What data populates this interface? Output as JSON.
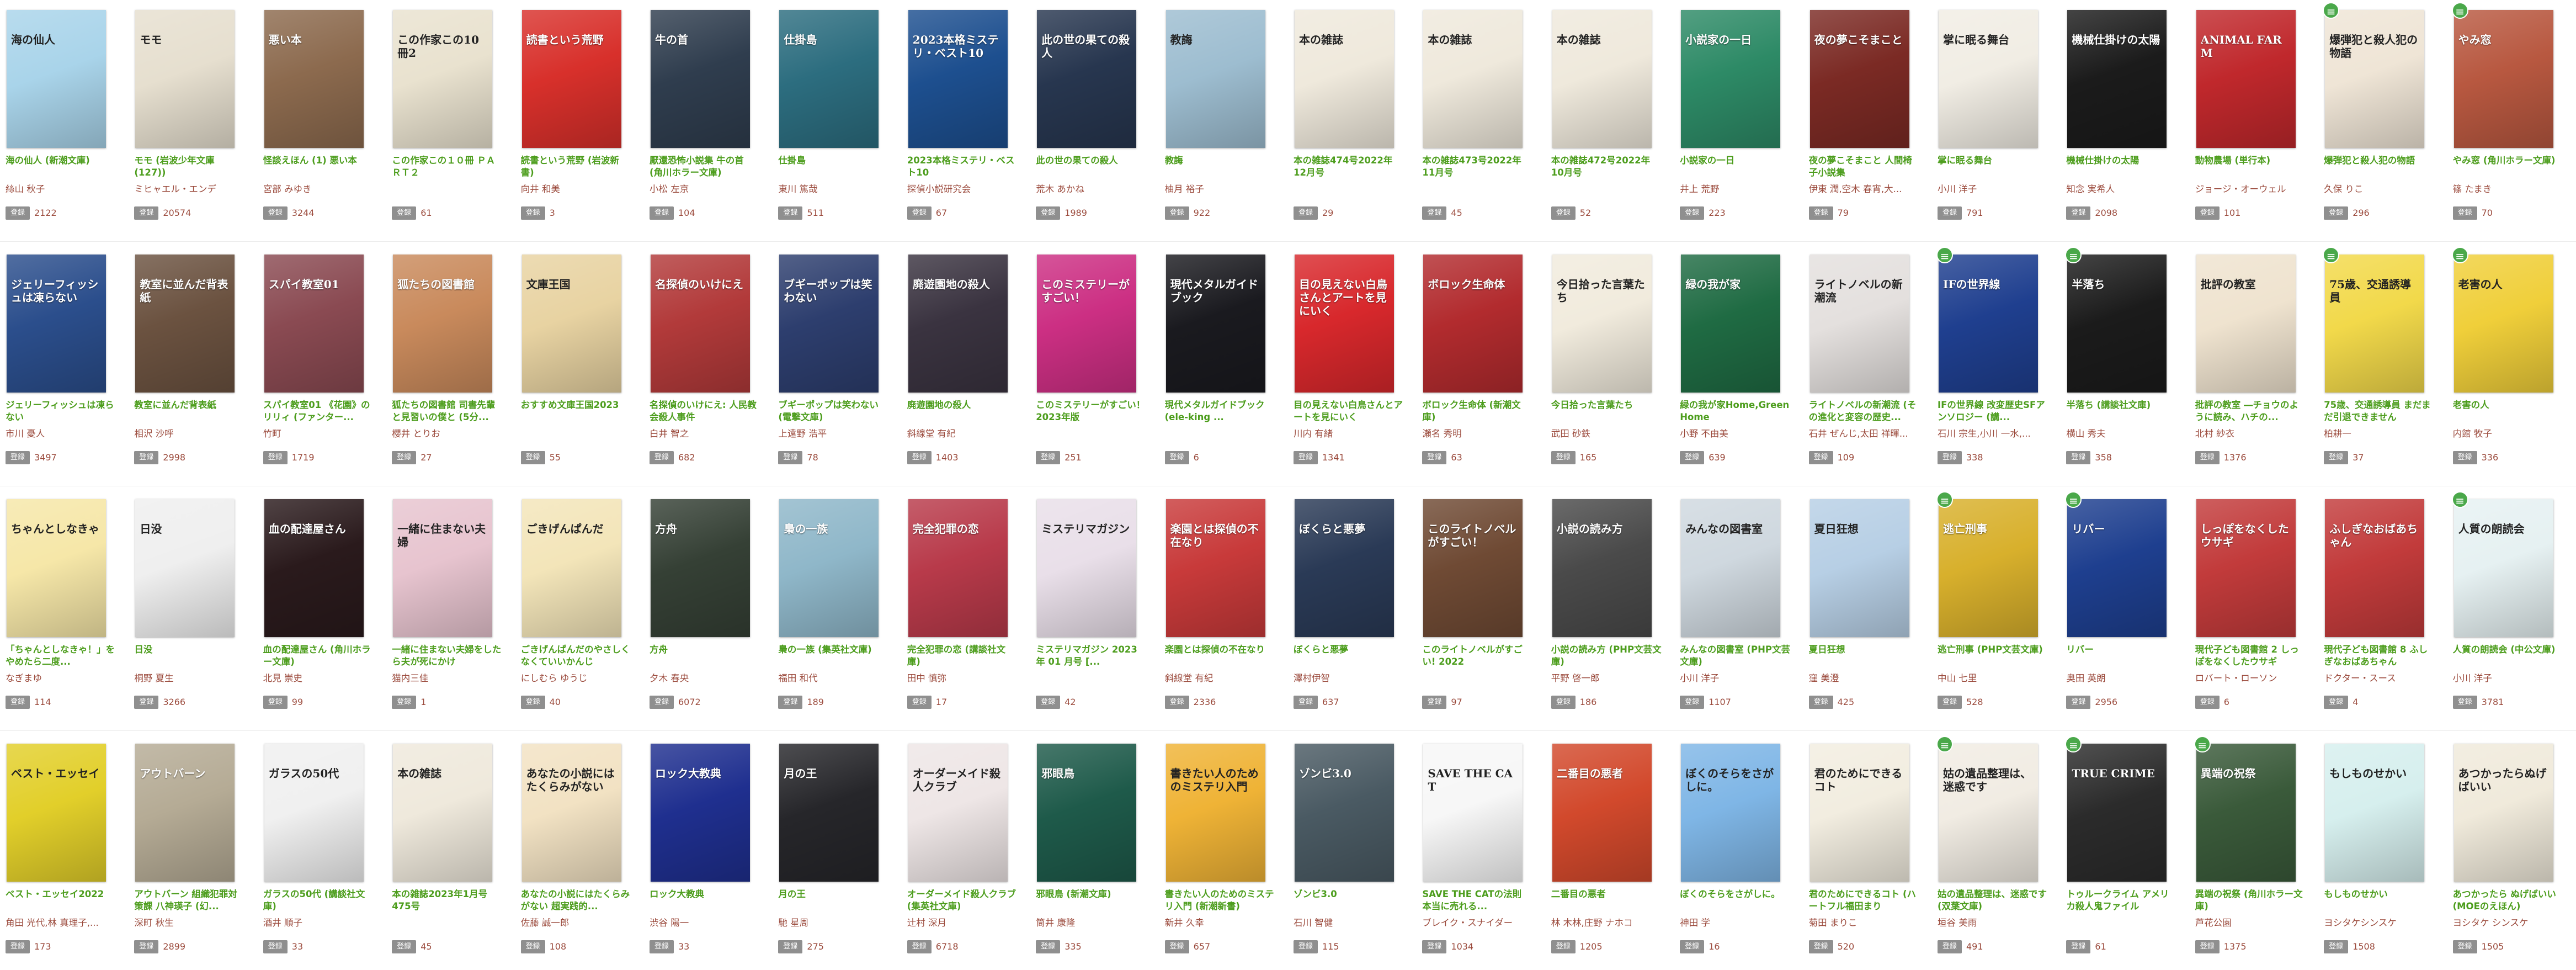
{
  "register_label": "登録",
  "books": [
    {
      "title": "海の仙人 (新潮文庫)",
      "author": "絲山 秋子",
      "count": "2122",
      "cover_text": "海の仙人",
      "color": "#a9d4ea",
      "light": true
    },
    {
      "title": "モモ (岩波少年文庫(127))",
      "author": "ミヒャエル・エンデ",
      "count": "20574",
      "cover_text": "モモ",
      "color": "#e6dfcf",
      "light": true
    },
    {
      "title": "怪談えほん (1) 悪い本",
      "author": "宮部 みゆき",
      "count": "3244",
      "cover_text": "悪い本",
      "color": "#8c6a4e"
    },
    {
      "title": "この作家この１０冊 ＰＡＲＴ２",
      "author": "",
      "count": "61",
      "cover_text": "この作家この10冊2",
      "color": "#e9e2cf",
      "light": true
    },
    {
      "title": "読書という荒野 (岩波新書)",
      "author": "向井 和美",
      "count": "3",
      "cover_text": "読書という荒野",
      "color": "#d8302b"
    },
    {
      "title": "厭還恐怖小説集 牛の首 (角川ホラー文庫)",
      "author": "小松 左京",
      "count": "104",
      "cover_text": "牛の首",
      "color": "#2f3d4e"
    },
    {
      "title": "仕掛島",
      "author": "東川 篤哉",
      "count": "511",
      "cover_text": "仕掛島",
      "color": "#2c6d7f"
    },
    {
      "title": "2023本格ミステリ・ベスト10",
      "author": "探偵小説研究会",
      "count": "67",
      "cover_text": "2023本格ミステリ・ベスト10",
      "color": "#1d4f8f"
    },
    {
      "title": "此の世の果ての殺人",
      "author": "荒木 あかね",
      "count": "1989",
      "cover_text": "此の世の果ての殺人",
      "color": "#27364f"
    },
    {
      "title": "教誨",
      "author": "柚月 裕子",
      "count": "922",
      "cover_text": "教誨",
      "color": "#9dbdd0",
      "light": true
    },
    {
      "title": "本の雑誌474号2022年12月号",
      "author": "",
      "count": "29",
      "cover_text": "本の雑誌",
      "color": "#efe9dc",
      "light": true
    },
    {
      "title": "本の雑誌473号2022年11月号",
      "author": "",
      "count": "45",
      "cover_text": "本の雑誌",
      "color": "#efe9dc",
      "light": true
    },
    {
      "title": "本の雑誌472号2022年10月号",
      "author": "",
      "count": "52",
      "cover_text": "本の雑誌",
      "color": "#efe9dc",
      "light": true
    },
    {
      "title": "小説家の一日",
      "author": "井上 荒野",
      "count": "223",
      "cover_text": "小説家の一日",
      "color": "#2d8a66"
    },
    {
      "title": "夜の夢こそまこと 人間椅子小説集",
      "author": "伊東 潤,空木 春宵,大...",
      "count": "79",
      "cover_text": "夜の夢こそまこと",
      "color": "#7b2a24"
    },
    {
      "title": "掌に眠る舞台",
      "author": "小川 洋子",
      "count": "791",
      "cover_text": "掌に眠る舞台",
      "color": "#f1ede4",
      "light": true
    },
    {
      "title": "機械仕掛けの太陽",
      "author": "知念 実希人",
      "count": "2098",
      "cover_text": "機械仕掛けの太陽",
      "color": "#1b1b1b"
    },
    {
      "title": "動物農場 (単行本)",
      "author": "ジョージ・オーウェル",
      "count": "101",
      "cover_text": "ANIMAL FARM",
      "color": "#c0282c"
    },
    {
      "title": "爆弾犯と殺人犯の物語",
      "author": "久保 りこ",
      "count": "296",
      "cover_text": "爆弾犯と殺人犯の物語",
      "color": "#efe5d6",
      "light": true,
      "badge": true
    },
    {
      "title": "やみ窓 (角川ホラー文庫)",
      "author": "篠 たまき",
      "count": "70",
      "cover_text": "やみ窓",
      "color": "#b85840",
      "badge": true
    },
    {
      "title": "ジェリーフィッシュは凍らない",
      "author": "市川 憂人",
      "count": "3497",
      "cover_text": "ジェリーフィッシュは凍らない",
      "color": "#2b4e8c"
    },
    {
      "title": "教室に並んだ背表紙",
      "author": "相沢 沙呼",
      "count": "2998",
      "cover_text": "教室に並んだ背表紙",
      "color": "#6b5240"
    },
    {
      "title": "スパイ教室01 《花園》のリリィ (ファンター...",
      "author": "竹町",
      "count": "1719",
      "cover_text": "スパイ教室01",
      "color": "#8a4a52"
    },
    {
      "title": "狐たちの図書館 司書先輩と見習いの僕と (5分...",
      "author": "櫻井 とりお",
      "count": "27",
      "cover_text": "狐たちの図書館",
      "color": "#c98a5c"
    },
    {
      "title": "おすすめ文庫王国2023",
      "author": "",
      "count": "55",
      "cover_text": "文庫王国",
      "color": "#e8d3a2",
      "light": true
    },
    {
      "title": "名探偵のいけにえ: 人民教会殺人事件",
      "author": "白井 智之",
      "count": "682",
      "cover_text": "名探偵のいけにえ",
      "color": "#b23a3a"
    },
    {
      "title": "ブギーポップは笑わない (電撃文庫)",
      "author": "上遠野 浩平",
      "count": "78",
      "cover_text": "ブギーポップは笑わない",
      "color": "#2d3e6e"
    },
    {
      "title": "廃遊園地の殺人",
      "author": "斜線堂 有紀",
      "count": "1403",
      "cover_text": "廃遊園地の殺人",
      "color": "#3a3340"
    },
    {
      "title": "このミステリーがすごい！2023年版",
      "author": "",
      "count": "251",
      "cover_text": "このミステリーがすごい！",
      "color": "#cc2f83"
    },
    {
      "title": "現代メタルガイドブック (ele-king ...",
      "author": "",
      "count": "6",
      "cover_text": "現代メタルガイドブック",
      "color": "#1a1a1f"
    },
    {
      "title": "目の見えない白鳥さんとアートを見にいく",
      "author": "川内 有緒",
      "count": "1341",
      "cover_text": "目の見えない白鳥さんとアートを見にいく",
      "color": "#d8282c"
    },
    {
      "title": "ボロック生命体 (新潮文庫)",
      "author": "瀬名 秀明",
      "count": "63",
      "cover_text": "ボロック生命体",
      "color": "#b22b2e"
    },
    {
      "title": "今日拾った言葉たち",
      "author": "武田 砂鉄",
      "count": "165",
      "cover_text": "今日拾った言葉たち",
      "color": "#f1ebdd",
      "light": true
    },
    {
      "title": "緑の我が家Home,Green Home",
      "author": "小野 不由美",
      "count": "639",
      "cover_text": "緑の我が家",
      "color": "#1f6b43"
    },
    {
      "title": "ライトノベルの新潮流 (その進化と変容の歴史...",
      "author": "石井 ぜんじ,太田 祥暉...",
      "count": "109",
      "cover_text": "ライトノベルの新潮流",
      "color": "#e4e0de",
      "light": true
    },
    {
      "title": "IFの世界線 改変歴史SFアンソロジー (講...",
      "author": "石川 宗生,小川 一水,...",
      "count": "338",
      "cover_text": "IFの世界線",
      "color": "#1f3f8f",
      "badge": true
    },
    {
      "title": "半落ち (講談社文庫)",
      "author": "横山 秀夫",
      "count": "358",
      "cover_text": "半落ち",
      "color": "#1b1b1b",
      "badge": true
    },
    {
      "title": "批評の教室 ―チョウのように読み、ハチの...",
      "author": "北村 紗衣",
      "count": "1376",
      "cover_text": "批評の教室",
      "color": "#efe3cf",
      "light": true
    },
    {
      "title": "75歳、交通誘導員 まだまだ引退できません",
      "author": "柏耕一",
      "count": "37",
      "cover_text": "75歳、交通誘導員",
      "color": "#f2d94a",
      "light": true,
      "badge": true
    },
    {
      "title": "老害の人",
      "author": "内館 牧子",
      "count": "336",
      "cover_text": "老害の人",
      "color": "#f0cf3a",
      "light": true,
      "badge": true
    },
    {
      "title": "「ちゃんとしなきゃ！」をやめたら二度...",
      "author": "なぎまゆ",
      "count": "114",
      "cover_text": "ちゃんとしなきゃ",
      "color": "#f6e7a8",
      "light": true
    },
    {
      "title": "日没",
      "author": "桐野 夏生",
      "count": "3266",
      "cover_text": "日没",
      "color": "#efefef",
      "light": true
    },
    {
      "title": "血の配達屋さん (角川ホラー文庫)",
      "author": "北見 崇史",
      "count": "99",
      "cover_text": "血の配達屋さん",
      "color": "#2a1a1c"
    },
    {
      "title": "一緒に住まない夫婦をしたら夫が死にかけ",
      "author": "猫内三佳",
      "count": "1",
      "cover_text": "一緒に住まない夫婦",
      "color": "#e7c4cf",
      "light": true
    },
    {
      "title": "ごきげんぱんだのやさしくなくていいかんじ",
      "author": "にしむら ゆうじ",
      "count": "40",
      "cover_text": "ごきげんぱんだ",
      "color": "#f3e5b9",
      "light": true
    },
    {
      "title": "方舟",
      "author": "夕木 春央",
      "count": "6072",
      "cover_text": "方舟",
      "color": "#354035"
    },
    {
      "title": "梟の一族 (集英社文庫)",
      "author": "福田 和代",
      "count": "189",
      "cover_text": "梟の一族",
      "color": "#8fb7c9"
    },
    {
      "title": "完全犯罪の恋 (講談社文庫)",
      "author": "田中 慎弥",
      "count": "17",
      "cover_text": "完全犯罪の恋",
      "color": "#b83a4a"
    },
    {
      "title": "ミステリマガジン 2023年 01 月号 [...",
      "author": "",
      "count": "42",
      "cover_text": "ミステリマガジン",
      "color": "#e9dfe9",
      "light": true
    },
    {
      "title": "楽園とは探偵の不在なり",
      "author": "斜線堂 有紀",
      "count": "2336",
      "cover_text": "楽園とは探偵の不在なり",
      "color": "#c83a3a"
    },
    {
      "title": "ぼくらと悪夢",
      "author": "澤村伊智",
      "count": "637",
      "cover_text": "ぼくらと悪夢",
      "color": "#2a3a56"
    },
    {
      "title": "このライトノベルがすごい! 2022",
      "author": "",
      "count": "97",
      "cover_text": "このライトノベルがすごい！",
      "color": "#6f4a34"
    },
    {
      "title": "小説の読み方 (PHP文芸文庫)",
      "author": "平野 啓一郎",
      "count": "186",
      "cover_text": "小説の読み方",
      "color": "#4a4a4a"
    },
    {
      "title": "みんなの図書室 (PHP文芸文庫)",
      "author": "小川 洋子",
      "count": "1107",
      "cover_text": "みんなの図書室",
      "color": "#cfd8df",
      "light": true
    },
    {
      "title": "夏日狂想",
      "author": "窪 美澄",
      "count": "425",
      "cover_text": "夏日狂想",
      "color": "#b7cfe5",
      "light": true
    },
    {
      "title": "逃亡刑事 (PHP文芸文庫)",
      "author": "中山 七里",
      "count": "528",
      "cover_text": "逃亡刑事",
      "color": "#d8b02c",
      "badge": true
    },
    {
      "title": "リバー",
      "author": "奥田 英朗",
      "count": "2956",
      "cover_text": "リバー",
      "color": "#1e3f8f",
      "badge": true
    },
    {
      "title": "現代子ども図書館 2 しっぽをなくしたウサギ",
      "author": "ロバート・ローソン",
      "count": "6",
      "cover_text": "しっぽをなくしたウサギ",
      "color": "#c23b3b"
    },
    {
      "title": "現代子ども図書館 8 ふしぎなおばあちゃん",
      "author": "ドクター・スース",
      "count": "4",
      "cover_text": "ふしぎなおばあちゃん",
      "color": "#c23b3b"
    },
    {
      "title": "人質の朗読会 (中公文庫)",
      "author": "小川 洋子",
      "count": "3781",
      "cover_text": "人質の朗読会",
      "color": "#e6f1f2",
      "light": true,
      "badge": true
    },
    {
      "title": "ベスト・エッセイ2022",
      "author": "角田 光代,林 真理子,...",
      "count": "173",
      "cover_text": "ベスト・エッセイ",
      "color": "#e2cf2a",
      "light": true
    },
    {
      "title": "アウトバーン 組織犯罪対策課 八神瑛子 (幻...",
      "author": "深町 秋生",
      "count": "2899",
      "cover_text": "アウトバーン",
      "color": "#b5ab95"
    },
    {
      "title": "ガラスの50代 (講談社文庫)",
      "author": "酒井 順子",
      "count": "33",
      "cover_text": "ガラスの50代",
      "color": "#f0f0f0",
      "light": true
    },
    {
      "title": "本の雑誌2023年1月号475号",
      "author": "",
      "count": "45",
      "cover_text": "本の雑誌",
      "color": "#efe9dc",
      "light": true
    },
    {
      "title": "あなたの小説にはたくらみがない 超実践的...",
      "author": "佐藤 誠一郎",
      "count": "108",
      "cover_text": "あなたの小説にはたくらみがない",
      "color": "#f2e2c3",
      "light": true
    },
    {
      "title": "ロック大教典",
      "author": "渋谷 陽一",
      "count": "33",
      "cover_text": "ロック大教典",
      "color": "#1f2f8f"
    },
    {
      "title": "月の王",
      "author": "馳 星周",
      "count": "275",
      "cover_text": "月の王",
      "color": "#26262a"
    },
    {
      "title": "オーダーメイド殺人クラブ (集英社文庫)",
      "author": "辻村 深月",
      "count": "6718",
      "cover_text": "オーダーメイド殺人クラブ",
      "color": "#eee6e6",
      "light": true
    },
    {
      "title": "邪眼鳥 (新潮文庫)",
      "author": "筒井 康隆",
      "count": "335",
      "cover_text": "邪眼鳥",
      "color": "#1e5a4a"
    },
    {
      "title": "書きたい人のためのミステリ入門 (新潮新書)",
      "author": "新井 久幸",
      "count": "657",
      "cover_text": "書きたい人のためのミステリ入門",
      "color": "#efb336",
      "light": true
    },
    {
      "title": "ゾンビ3.0",
      "author": "石川 智健",
      "count": "115",
      "cover_text": "ゾンビ3.0",
      "color": "#4a5a63"
    },
    {
      "title": "SAVE THE CATの法則 本当に売れる...",
      "author": "ブレイク・スナイダー",
      "count": "1034",
      "cover_text": "SAVE THE CAT",
      "color": "#f7f7f7",
      "light": true
    },
    {
      "title": "二番目の悪者",
      "author": "林 木林,庄野 ナホコ",
      "count": "1205",
      "cover_text": "二番目の悪者",
      "color": "#d2492c"
    },
    {
      "title": "ぼくのそらをさがしに。",
      "author": "神田 学",
      "count": "16",
      "cover_text": "ぼくのそらをさがしに。",
      "color": "#7fb6e6",
      "light": true
    },
    {
      "title": "君のためにできるコト (ハートフル福田まり",
      "author": "菊田 まりこ",
      "count": "520",
      "cover_text": "君のためにできるコト",
      "color": "#f2ede0",
      "light": true
    },
    {
      "title": "姑の遺品整理は、迷惑です (双葉文庫)",
      "author": "垣谷 美雨",
      "count": "491",
      "cover_text": "姑の遺品整理は、迷惑です",
      "color": "#f1ece3",
      "light": true,
      "badge": true
    },
    {
      "title": "トゥルークライム アメリカ殺人鬼ファイル",
      "author": "",
      "count": "61",
      "cover_text": "TRUE CRIME",
      "color": "#2b2b2b",
      "badge": true
    },
    {
      "title": "異端の祝祭 (角川ホラー文庫)",
      "author": "芦花公園",
      "count": "1375",
      "cover_text": "異端の祝祭",
      "color": "#3a5a3a",
      "badge": true
    },
    {
      "title": "もしものせかい",
      "author": "ヨシタケシンスケ",
      "count": "1508",
      "cover_text": "もしものせかい",
      "color": "#d6efee",
      "light": true
    },
    {
      "title": "あつかったら ぬげばいい (MOEのえほん)",
      "author": "ヨシタケ シンスケ",
      "count": "1505",
      "cover_text": "あつかったらぬげばいい",
      "color": "#f0eadb",
      "light": true
    }
  ]
}
